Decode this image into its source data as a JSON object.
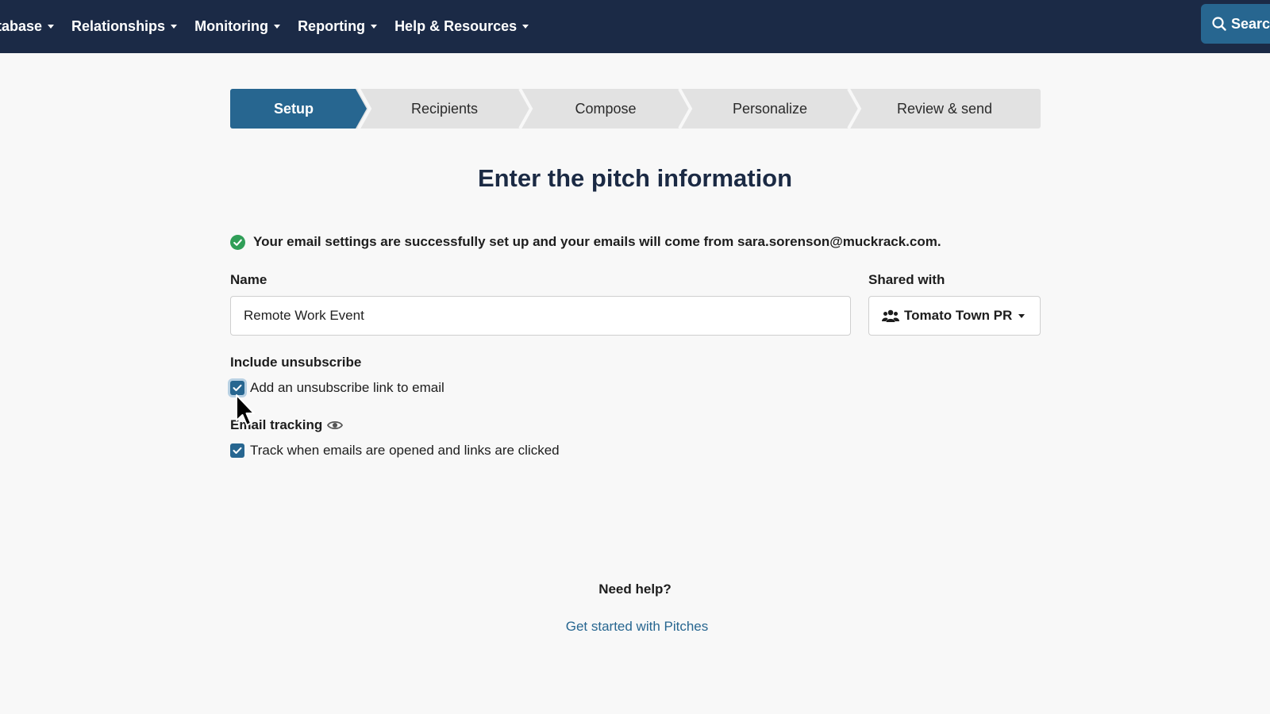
{
  "nav": {
    "items": [
      {
        "label": "tabase"
      },
      {
        "label": "Relationships"
      },
      {
        "label": "Monitoring"
      },
      {
        "label": "Reporting"
      },
      {
        "label": "Help & Resources"
      }
    ],
    "search_label": "Search"
  },
  "stepper": {
    "steps": [
      {
        "label": "Setup",
        "active": true
      },
      {
        "label": "Recipients"
      },
      {
        "label": "Compose"
      },
      {
        "label": "Personalize"
      },
      {
        "label": "Review & send"
      }
    ]
  },
  "page": {
    "title": "Enter the pitch information"
  },
  "notice": {
    "text": "Your email settings are successfully set up and your emails will come from sara.sorenson@muckrack.com."
  },
  "form": {
    "name_label": "Name",
    "name_value": "Remote Work Event",
    "shared_label": "Shared with",
    "shared_value": "Tomato Town PR",
    "unsubscribe_label": "Include unsubscribe",
    "unsubscribe_option": "Add an unsubscribe link to email",
    "tracking_label": "Email tracking",
    "tracking_option": "Track when emails are opened and links are clicked"
  },
  "help": {
    "title": "Need help?",
    "link": "Get started with Pitches"
  },
  "colors": {
    "nav_bg": "#1b2a46",
    "accent": "#276690",
    "step_inactive": "#e2e2e2",
    "success": "#2f9e57"
  }
}
